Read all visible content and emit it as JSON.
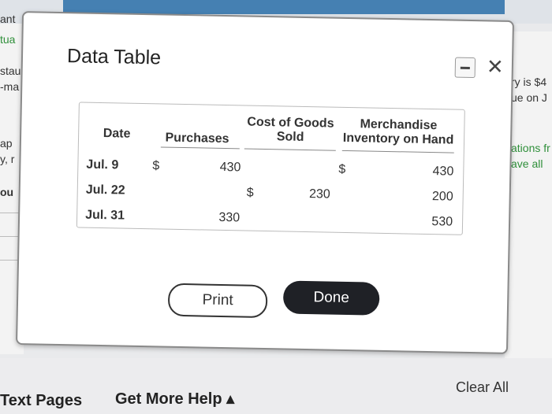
{
  "background": {
    "left_fragments": [
      "ant",
      "tua",
      "stau",
      "-ma",
      "ap",
      "y, r",
      "ou"
    ],
    "right_fragments": [
      "ry is $4",
      "ue on J",
      "ations fr",
      "ave all"
    ]
  },
  "bottom_bar": {
    "next_pages": "Text Pages",
    "get_more_help": "Get More Help ▴",
    "clear_all": "Clear All"
  },
  "modal": {
    "title": "Data Table",
    "minimize_icon": "minimize-icon",
    "close_symbol": "✕",
    "table": {
      "headers": {
        "date": "Date",
        "purchases": "Purchases",
        "cogs": "Cost of Goods Sold",
        "inventory": "Merchandise Inventory on Hand"
      },
      "rows": [
        {
          "date": "Jul. 9",
          "purchases_sign": "$",
          "purchases": "430",
          "cogs_sign": "",
          "cogs": "",
          "inv_sign": "$",
          "inventory": "430"
        },
        {
          "date": "Jul. 22",
          "purchases_sign": "",
          "purchases": "",
          "cogs_sign": "$",
          "cogs": "230",
          "inv_sign": "",
          "inventory": "200"
        },
        {
          "date": "Jul. 31",
          "purchases_sign": "",
          "purchases": "330",
          "cogs_sign": "",
          "cogs": "",
          "inv_sign": "",
          "inventory": "530"
        }
      ]
    },
    "print_label": "Print",
    "done_label": "Done"
  }
}
